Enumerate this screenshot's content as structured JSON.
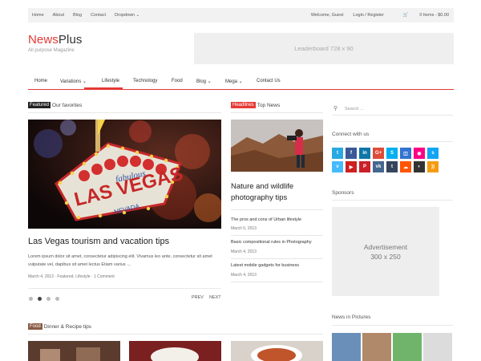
{
  "topbar": {
    "nav": [
      "Home",
      "About",
      "Blog",
      "Contact",
      "Dropdown ⌄"
    ],
    "welcome": "Welcome, Guest",
    "login": "Login / Register",
    "cart": "0 Items - $0.00"
  },
  "brand": {
    "name_red": "News",
    "name_dark": "Plus",
    "tagline": "All purpose Magazine"
  },
  "leaderboard": "Leaderboard 728 x 90",
  "mainnav": [
    "Home",
    "Variations ⌄",
    "Lifestyle",
    "Technology",
    "Food",
    "Blog ⌄",
    "Mega ⌄",
    "Contact Us"
  ],
  "featured": {
    "tag": "Featured",
    "label": "Our favorites",
    "title": "Las Vegas tourism and vacation tips",
    "excerpt": "Lorem ipsum dolor sit amet, consectetur adipiscing elit. Vivamus leo ante, consectetur sit amet vulputate vel, dapibus sit amet lectus Etiam varius ...",
    "meta": "March 4, 2013 · Featured, Lifestyle · 1 Comment",
    "sign": {
      "small": "fabulous",
      "main": "LAS VEGAS",
      "state": "NEVADA"
    },
    "prev": "PREV",
    "next": "NEXT"
  },
  "headlines": {
    "tag": "Headlines",
    "label": "Top News",
    "title": "Nature and wildlife photography tips",
    "items": [
      {
        "title": "The pros and cons of Urban lifestyle",
        "date": "March 5, 2013"
      },
      {
        "title": "Basic compositional rules in Photography",
        "date": "March 4, 2013"
      },
      {
        "title": "Latest mobile gadgets for business",
        "date": "March 4, 2013"
      }
    ]
  },
  "sidebar": {
    "search_placeholder": "Search ...",
    "connect": "Connect with us",
    "sponsors": "Sponsors",
    "ad_line1": "Advertisement",
    "ad_line2": "300 x 250",
    "pictures": "News in Pictures"
  },
  "food": {
    "tag": "Food",
    "label": "Dinner & Recipe tips"
  },
  "social_icons": [
    {
      "name": "twitter-icon",
      "color": "#29a9e1",
      "glyph": "t"
    },
    {
      "name": "facebook-icon",
      "color": "#3b5998",
      "glyph": "f"
    },
    {
      "name": "linkedin-icon",
      "color": "#0e76a8",
      "glyph": "in"
    },
    {
      "name": "google-plus-icon",
      "color": "#dd4b39",
      "glyph": "G+"
    },
    {
      "name": "skype-icon",
      "color": "#00aff0",
      "glyph": "S"
    },
    {
      "name": "delicious-icon",
      "color": "#3274d1",
      "glyph": "◫"
    },
    {
      "name": "flickr-icon",
      "color": "#ff0084",
      "glyph": "◉"
    },
    {
      "name": "skype-alt-icon",
      "color": "#12a5f4",
      "glyph": "s"
    },
    {
      "name": "vimeo-icon",
      "color": "#44bbff",
      "glyph": "v"
    },
    {
      "name": "youtube-icon",
      "color": "#cd201f",
      "glyph": "▶"
    },
    {
      "name": "pinterest-icon",
      "color": "#cb2027",
      "glyph": "P"
    },
    {
      "name": "vk-icon",
      "color": "#45668e",
      "glyph": "vk"
    },
    {
      "name": "tumblr-icon",
      "color": "#35465c",
      "glyph": "t"
    },
    {
      "name": "soundcloud-icon",
      "color": "#ff5500",
      "glyph": "☁"
    },
    {
      "name": "github-icon",
      "color": "#333333",
      "glyph": "◐"
    },
    {
      "name": "rss-icon",
      "color": "#f39c12",
      "glyph": "))"
    }
  ],
  "colors": {
    "accent": "#e53935",
    "tag_dark": "#222222",
    "tag_food": "#8a5a44"
  }
}
